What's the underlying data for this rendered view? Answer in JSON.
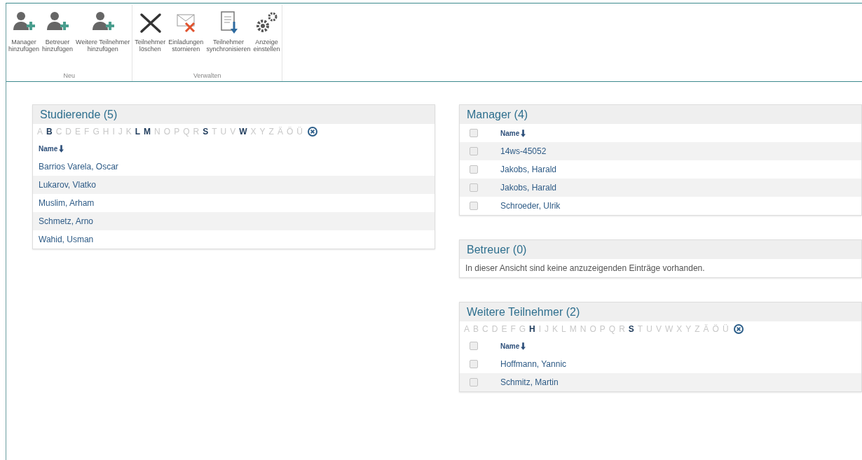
{
  "ribbon": {
    "groups": [
      {
        "label": "Neu",
        "buttons": [
          {
            "kind": "person-add",
            "label": "Manager\nhinzufügen"
          },
          {
            "kind": "person-add",
            "label": "Betreuer\nhinzufügen"
          },
          {
            "kind": "person-add",
            "label": "Weitere Teilnehmer\nhinzufügen"
          }
        ]
      },
      {
        "label": "Verwalten",
        "buttons": [
          {
            "kind": "delete",
            "label": "Teilnehmer\nlöschen"
          },
          {
            "kind": "cancel-invite",
            "label": "Einladungen\nstornieren"
          },
          {
            "kind": "sync",
            "label": "Teilnehmer\nsynchronisieren"
          },
          {
            "kind": "settings",
            "label": "Anzeige\neinstellen"
          }
        ]
      }
    ]
  },
  "left": [
    {
      "title": "Studierende (5)",
      "letters": [
        {
          "letter": "A",
          "active": false
        },
        {
          "letter": "B",
          "active": true
        },
        {
          "letter": "C",
          "active": false
        },
        {
          "letter": "D",
          "active": false
        },
        {
          "letter": "E",
          "active": false
        },
        {
          "letter": "F",
          "active": false
        },
        {
          "letter": "G",
          "active": false
        },
        {
          "letter": "H",
          "active": false
        },
        {
          "letter": "I",
          "active": false
        },
        {
          "letter": "J",
          "active": false
        },
        {
          "letter": "K",
          "active": false
        },
        {
          "letter": "L",
          "active": true
        },
        {
          "letter": "M",
          "active": true
        },
        {
          "letter": "N",
          "active": false
        },
        {
          "letter": "O",
          "active": false
        },
        {
          "letter": "P",
          "active": false
        },
        {
          "letter": "Q",
          "active": false
        },
        {
          "letter": "R",
          "active": false
        },
        {
          "letter": "S",
          "active": true
        },
        {
          "letter": "T",
          "active": false
        },
        {
          "letter": "U",
          "active": false
        },
        {
          "letter": "V",
          "active": false
        },
        {
          "letter": "W",
          "active": true
        },
        {
          "letter": "X",
          "active": false
        },
        {
          "letter": "Y",
          "active": false
        },
        {
          "letter": "Z",
          "active": false
        },
        {
          "letter": "Ä",
          "active": false
        },
        {
          "letter": "Ö",
          "active": false
        },
        {
          "letter": "Ü",
          "active": false
        }
      ],
      "column": "Name",
      "rows": [
        {
          "name": "Barrios Varela, Oscar"
        },
        {
          "name": "Lukarov, Vlatko"
        },
        {
          "name": "Muslim, Arham"
        },
        {
          "name": "Schmetz, Arno"
        },
        {
          "name": "Wahid, Usman"
        }
      ]
    }
  ],
  "right": [
    {
      "title": "Manager (4)",
      "header_checked": false,
      "column": "Name",
      "rows": [
        {
          "name": "14ws-45052",
          "checked": false
        },
        {
          "name": "Jakobs, Harald",
          "checked": false
        },
        {
          "name": "Jakobs, Harald",
          "checked": false
        },
        {
          "name": "Schroeder, Ulrik",
          "checked": false
        }
      ]
    },
    {
      "title": "Betreuer (0)",
      "empty_message": "In dieser Ansicht sind keine anzuzeigenden Einträge vorhanden."
    },
    {
      "title": "Weitere Teilnehmer (2)",
      "header_checked": false,
      "letters": [
        {
          "letter": "A",
          "active": false
        },
        {
          "letter": "B",
          "active": false
        },
        {
          "letter": "C",
          "active": false
        },
        {
          "letter": "D",
          "active": false
        },
        {
          "letter": "E",
          "active": false
        },
        {
          "letter": "F",
          "active": false
        },
        {
          "letter": "G",
          "active": false
        },
        {
          "letter": "H",
          "active": true
        },
        {
          "letter": "I",
          "active": false
        },
        {
          "letter": "J",
          "active": false
        },
        {
          "letter": "K",
          "active": false
        },
        {
          "letter": "L",
          "active": false
        },
        {
          "letter": "M",
          "active": false
        },
        {
          "letter": "N",
          "active": false
        },
        {
          "letter": "O",
          "active": false
        },
        {
          "letter": "P",
          "active": false
        },
        {
          "letter": "Q",
          "active": false
        },
        {
          "letter": "R",
          "active": false
        },
        {
          "letter": "S",
          "active": true
        },
        {
          "letter": "T",
          "active": false
        },
        {
          "letter": "U",
          "active": false
        },
        {
          "letter": "V",
          "active": false
        },
        {
          "letter": "W",
          "active": false
        },
        {
          "letter": "X",
          "active": false
        },
        {
          "letter": "Y",
          "active": false
        },
        {
          "letter": "Z",
          "active": false
        },
        {
          "letter": "Ä",
          "active": false
        },
        {
          "letter": "Ö",
          "active": false
        },
        {
          "letter": "Ü",
          "active": false
        }
      ],
      "column": "Name",
      "rows": [
        {
          "name": "Hoffmann, Yannic",
          "checked": false
        },
        {
          "name": "Schmitz, Martin",
          "checked": false
        }
      ]
    }
  ]
}
